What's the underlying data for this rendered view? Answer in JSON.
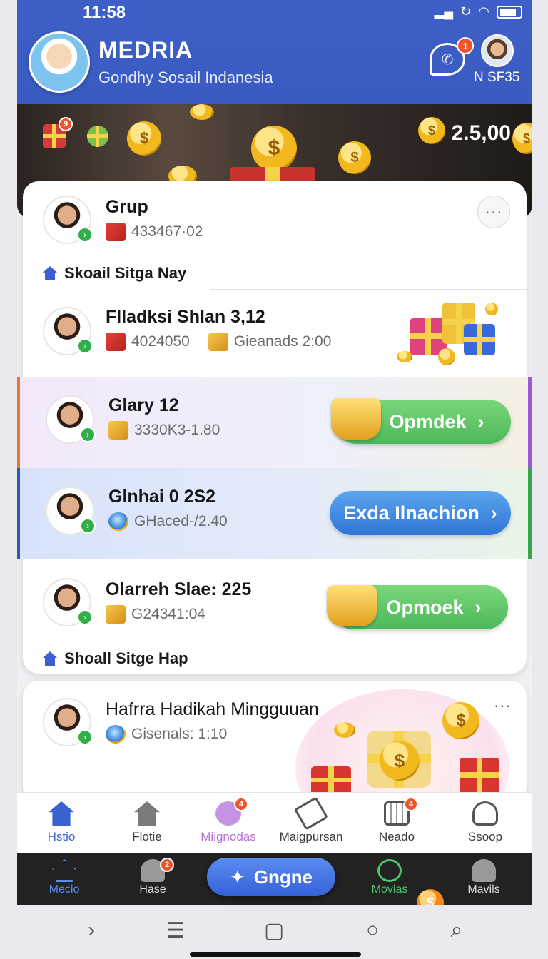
{
  "status_bar": {
    "time": "11:58"
  },
  "header": {
    "title": "MEDRIA",
    "subtitle": "Gondhy Sosail Indanesia",
    "chat_badge": "1",
    "profile_code": "N SF35"
  },
  "banner": {
    "amount": "2.5,00",
    "gift_badge": "9",
    "coin_symbol": "$"
  },
  "rows": [
    {
      "title": "Grup",
      "meta1": "433467·02"
    },
    {
      "title": "Flladksi Shlan 3,12",
      "meta1": "4024050",
      "meta2": "Gieanads 2:00"
    },
    {
      "title": "Glary 12",
      "meta1": "3330K3-1.80",
      "cta": "Opmdek"
    },
    {
      "title": "Glnhai 0 2S2",
      "meta1": "GHaced-/2.40",
      "cta": "Exda Ilnachion"
    },
    {
      "title": "Olarreh Slae: 225",
      "meta1": "G24341:04",
      "cta": "Opmoek"
    },
    {
      "title": "Hafrra Hadikah Mingguuan",
      "meta1": "Gisenals: 1:10"
    }
  ],
  "sections": {
    "label1": "Skoail Sitga Nay",
    "label2": "Shoall Sitge Hap"
  },
  "nav_top": [
    {
      "label": "Hstio",
      "icon": "home-icon"
    },
    {
      "label": "Flotie",
      "icon": "house-icon"
    },
    {
      "label": "Miignodas",
      "icon": "chat-bubble-icon",
      "badge": "4"
    },
    {
      "label": "Maigpursan",
      "icon": "tag-icon"
    },
    {
      "label": "Neado",
      "icon": "calendar-icon",
      "badge": "4"
    },
    {
      "label": "Ssoop",
      "icon": "person-icon"
    }
  ],
  "nav_bottom": [
    {
      "label": "Mecio",
      "icon": "home-outline-icon"
    },
    {
      "label": "Hase",
      "icon": "user-icon",
      "badge": "2"
    },
    {
      "label": "Movias",
      "icon": "clock-icon"
    },
    {
      "label": "Mavils",
      "icon": "profile-icon"
    }
  ],
  "fab": {
    "label": "Gngne"
  },
  "colors": {
    "primary": "#3d5fc7",
    "green": "#4cb85a",
    "blue": "#2f75d6",
    "badge": "#f0542b"
  }
}
